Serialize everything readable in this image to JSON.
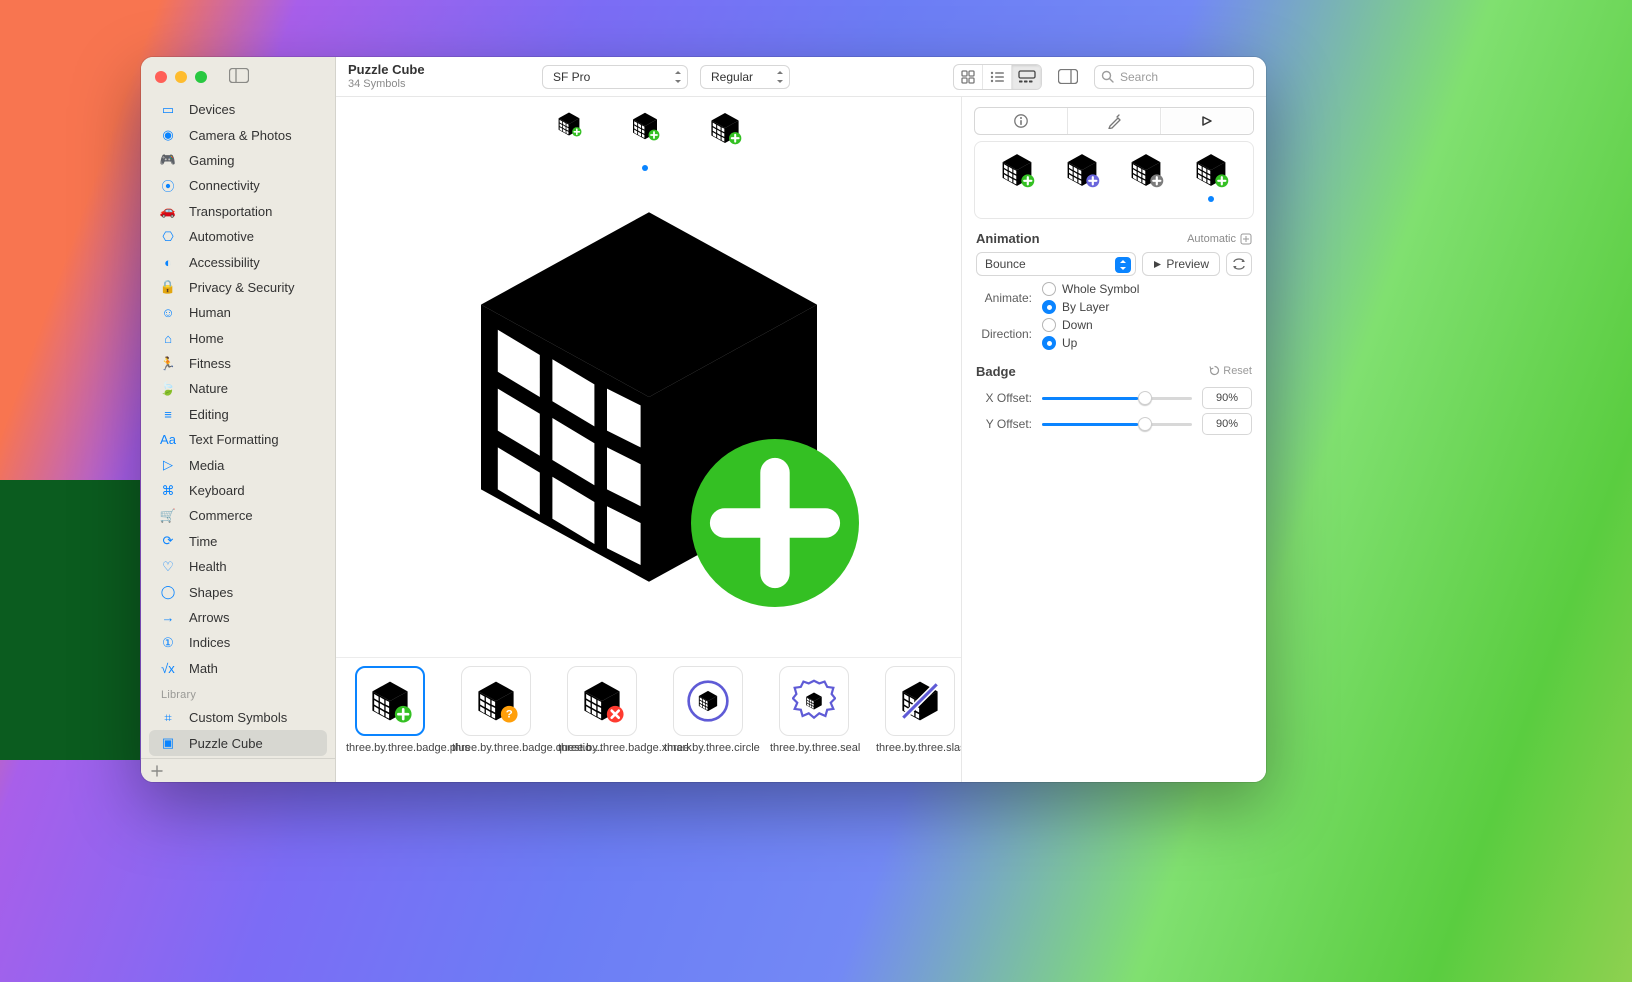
{
  "header": {
    "title": "Puzzle Cube",
    "subtitle": "34 Symbols",
    "font_select": "SF Pro",
    "weight_select": "Regular",
    "search_placeholder": "Search"
  },
  "sidebar": {
    "categories": [
      "Devices",
      "Camera & Photos",
      "Gaming",
      "Connectivity",
      "Transportation",
      "Automotive",
      "Accessibility",
      "Privacy & Security",
      "Human",
      "Home",
      "Fitness",
      "Nature",
      "Editing",
      "Text Formatting",
      "Media",
      "Keyboard",
      "Commerce",
      "Time",
      "Health",
      "Shapes",
      "Arrows",
      "Indices",
      "Math"
    ],
    "library_header": "Library",
    "library": [
      "Custom Symbols",
      "Puzzle Cube"
    ]
  },
  "symbols": [
    {
      "name": "three.by.three.badge.plus"
    },
    {
      "name": "three.by.three.badge.questio…"
    },
    {
      "name": "three.by.three.badge.xmark"
    },
    {
      "name": "three.by.three.circle"
    },
    {
      "name": "three.by.three.seal"
    },
    {
      "name": "three.by.three.slash"
    }
  ],
  "inspector": {
    "animation_header": "Animation",
    "automatic_label": "Automatic",
    "preset_select": "Bounce",
    "preview_button": "Preview",
    "animate_label": "Animate:",
    "animate_opt0": "Whole Symbol",
    "animate_opt1": "By Layer",
    "direction_label": "Direction:",
    "direction_opt0": "Down",
    "direction_opt1": "Up",
    "badge_header": "Badge",
    "reset_label": "Reset",
    "x_offset_label": "X Offset:",
    "x_offset_value": "90%",
    "y_offset_label": "Y Offset:",
    "y_offset_value": "90%"
  }
}
